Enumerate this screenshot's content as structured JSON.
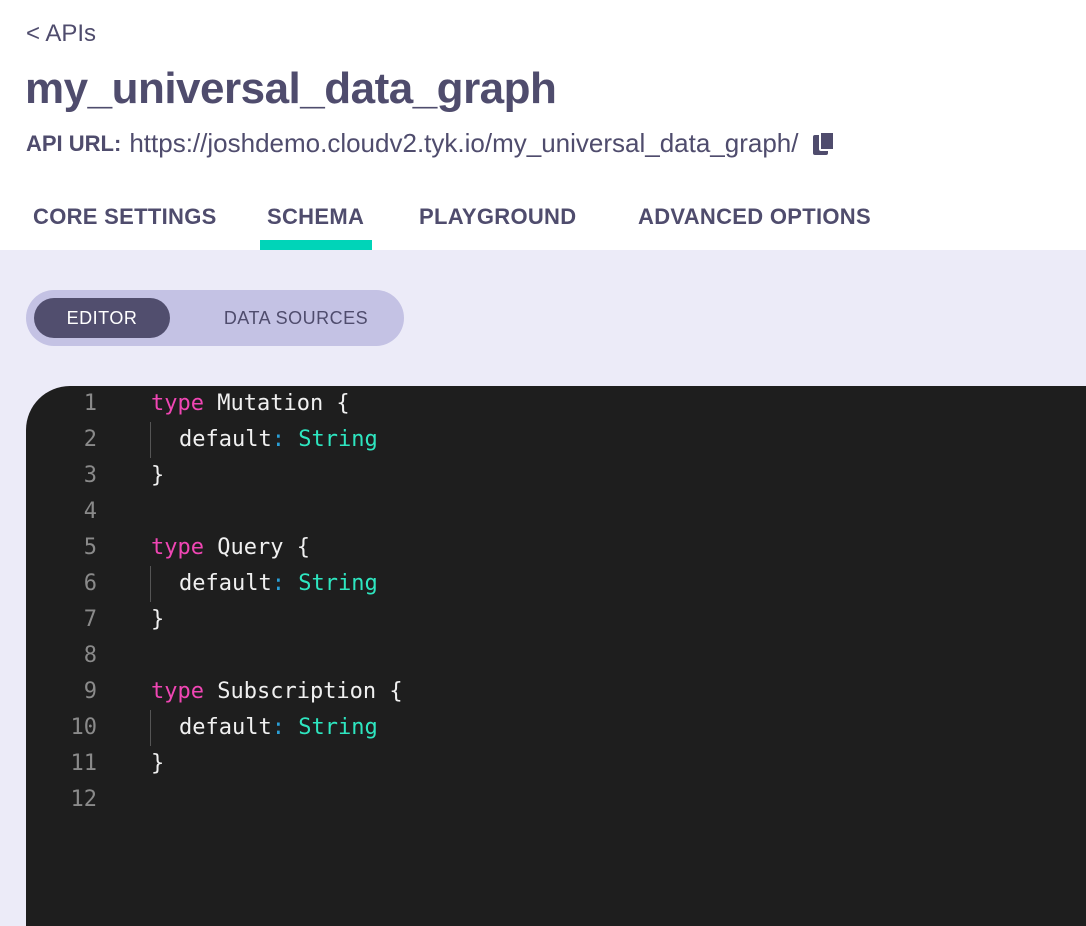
{
  "header": {
    "back_label": "< APIs",
    "title": "my_universal_data_graph",
    "api_url_label": "API URL:",
    "api_url": "https://joshdemo.cloudv2.tyk.io/my_universal_data_graph/",
    "copy_icon": "copy-icon"
  },
  "tabs": [
    {
      "label": "CORE SETTINGS"
    },
    {
      "label": "SCHEMA",
      "active": true
    },
    {
      "label": "PLAYGROUND"
    },
    {
      "label": "ADVANCED OPTIONS"
    }
  ],
  "accent_color": "#00d4b8",
  "toggle": {
    "editor": "EDITOR",
    "data_sources": "DATA SOURCES",
    "selected": "EDITOR"
  },
  "editor": {
    "lines": [
      {
        "n": "1",
        "kw": "type",
        "name": " Mutation {"
      },
      {
        "n": "2",
        "field": "default",
        "colon": ":",
        "type": " String"
      },
      {
        "n": "3",
        "text": "}"
      },
      {
        "n": "4",
        "text": ""
      },
      {
        "n": "5",
        "kw": "type",
        "name": " Query {"
      },
      {
        "n": "6",
        "field": "default",
        "colon": ":",
        "type": " String"
      },
      {
        "n": "7",
        "text": "}"
      },
      {
        "n": "8",
        "text": ""
      },
      {
        "n": "9",
        "kw": "type",
        "name": " Subscription {"
      },
      {
        "n": "10",
        "field": "default",
        "colon": ":",
        "type": " String"
      },
      {
        "n": "11",
        "text": "}"
      },
      {
        "n": "12",
        "text": ""
      }
    ]
  }
}
